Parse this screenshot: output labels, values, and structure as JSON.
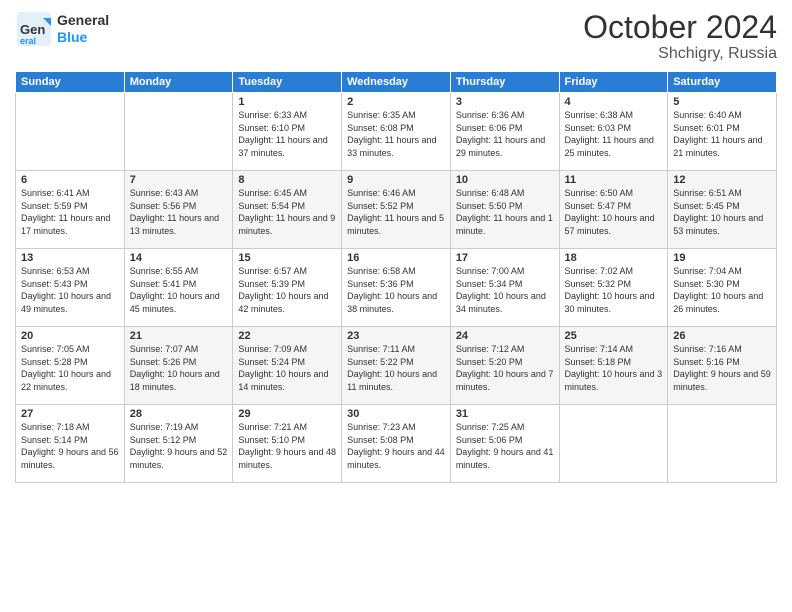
{
  "logo": {
    "general": "General",
    "blue": "Blue"
  },
  "header": {
    "month": "October 2024",
    "location": "Shchigry, Russia"
  },
  "weekdays": [
    "Sunday",
    "Monday",
    "Tuesday",
    "Wednesday",
    "Thursday",
    "Friday",
    "Saturday"
  ],
  "weeks": [
    [
      {
        "day": "",
        "sunrise": "",
        "sunset": "",
        "daylight": ""
      },
      {
        "day": "",
        "sunrise": "",
        "sunset": "",
        "daylight": ""
      },
      {
        "day": "1",
        "sunrise": "Sunrise: 6:33 AM",
        "sunset": "Sunset: 6:10 PM",
        "daylight": "Daylight: 11 hours and 37 minutes."
      },
      {
        "day": "2",
        "sunrise": "Sunrise: 6:35 AM",
        "sunset": "Sunset: 6:08 PM",
        "daylight": "Daylight: 11 hours and 33 minutes."
      },
      {
        "day": "3",
        "sunrise": "Sunrise: 6:36 AM",
        "sunset": "Sunset: 6:06 PM",
        "daylight": "Daylight: 11 hours and 29 minutes."
      },
      {
        "day": "4",
        "sunrise": "Sunrise: 6:38 AM",
        "sunset": "Sunset: 6:03 PM",
        "daylight": "Daylight: 11 hours and 25 minutes."
      },
      {
        "day": "5",
        "sunrise": "Sunrise: 6:40 AM",
        "sunset": "Sunset: 6:01 PM",
        "daylight": "Daylight: 11 hours and 21 minutes."
      }
    ],
    [
      {
        "day": "6",
        "sunrise": "Sunrise: 6:41 AM",
        "sunset": "Sunset: 5:59 PM",
        "daylight": "Daylight: 11 hours and 17 minutes."
      },
      {
        "day": "7",
        "sunrise": "Sunrise: 6:43 AM",
        "sunset": "Sunset: 5:56 PM",
        "daylight": "Daylight: 11 hours and 13 minutes."
      },
      {
        "day": "8",
        "sunrise": "Sunrise: 6:45 AM",
        "sunset": "Sunset: 5:54 PM",
        "daylight": "Daylight: 11 hours and 9 minutes."
      },
      {
        "day": "9",
        "sunrise": "Sunrise: 6:46 AM",
        "sunset": "Sunset: 5:52 PM",
        "daylight": "Daylight: 11 hours and 5 minutes."
      },
      {
        "day": "10",
        "sunrise": "Sunrise: 6:48 AM",
        "sunset": "Sunset: 5:50 PM",
        "daylight": "Daylight: 11 hours and 1 minute."
      },
      {
        "day": "11",
        "sunrise": "Sunrise: 6:50 AM",
        "sunset": "Sunset: 5:47 PM",
        "daylight": "Daylight: 10 hours and 57 minutes."
      },
      {
        "day": "12",
        "sunrise": "Sunrise: 6:51 AM",
        "sunset": "Sunset: 5:45 PM",
        "daylight": "Daylight: 10 hours and 53 minutes."
      }
    ],
    [
      {
        "day": "13",
        "sunrise": "Sunrise: 6:53 AM",
        "sunset": "Sunset: 5:43 PM",
        "daylight": "Daylight: 10 hours and 49 minutes."
      },
      {
        "day": "14",
        "sunrise": "Sunrise: 6:55 AM",
        "sunset": "Sunset: 5:41 PM",
        "daylight": "Daylight: 10 hours and 45 minutes."
      },
      {
        "day": "15",
        "sunrise": "Sunrise: 6:57 AM",
        "sunset": "Sunset: 5:39 PM",
        "daylight": "Daylight: 10 hours and 42 minutes."
      },
      {
        "day": "16",
        "sunrise": "Sunrise: 6:58 AM",
        "sunset": "Sunset: 5:36 PM",
        "daylight": "Daylight: 10 hours and 38 minutes."
      },
      {
        "day": "17",
        "sunrise": "Sunrise: 7:00 AM",
        "sunset": "Sunset: 5:34 PM",
        "daylight": "Daylight: 10 hours and 34 minutes."
      },
      {
        "day": "18",
        "sunrise": "Sunrise: 7:02 AM",
        "sunset": "Sunset: 5:32 PM",
        "daylight": "Daylight: 10 hours and 30 minutes."
      },
      {
        "day": "19",
        "sunrise": "Sunrise: 7:04 AM",
        "sunset": "Sunset: 5:30 PM",
        "daylight": "Daylight: 10 hours and 26 minutes."
      }
    ],
    [
      {
        "day": "20",
        "sunrise": "Sunrise: 7:05 AM",
        "sunset": "Sunset: 5:28 PM",
        "daylight": "Daylight: 10 hours and 22 minutes."
      },
      {
        "day": "21",
        "sunrise": "Sunrise: 7:07 AM",
        "sunset": "Sunset: 5:26 PM",
        "daylight": "Daylight: 10 hours and 18 minutes."
      },
      {
        "day": "22",
        "sunrise": "Sunrise: 7:09 AM",
        "sunset": "Sunset: 5:24 PM",
        "daylight": "Daylight: 10 hours and 14 minutes."
      },
      {
        "day": "23",
        "sunrise": "Sunrise: 7:11 AM",
        "sunset": "Sunset: 5:22 PM",
        "daylight": "Daylight: 10 hours and 11 minutes."
      },
      {
        "day": "24",
        "sunrise": "Sunrise: 7:12 AM",
        "sunset": "Sunset: 5:20 PM",
        "daylight": "Daylight: 10 hours and 7 minutes."
      },
      {
        "day": "25",
        "sunrise": "Sunrise: 7:14 AM",
        "sunset": "Sunset: 5:18 PM",
        "daylight": "Daylight: 10 hours and 3 minutes."
      },
      {
        "day": "26",
        "sunrise": "Sunrise: 7:16 AM",
        "sunset": "Sunset: 5:16 PM",
        "daylight": "Daylight: 9 hours and 59 minutes."
      }
    ],
    [
      {
        "day": "27",
        "sunrise": "Sunrise: 7:18 AM",
        "sunset": "Sunset: 5:14 PM",
        "daylight": "Daylight: 9 hours and 56 minutes."
      },
      {
        "day": "28",
        "sunrise": "Sunrise: 7:19 AM",
        "sunset": "Sunset: 5:12 PM",
        "daylight": "Daylight: 9 hours and 52 minutes."
      },
      {
        "day": "29",
        "sunrise": "Sunrise: 7:21 AM",
        "sunset": "Sunset: 5:10 PM",
        "daylight": "Daylight: 9 hours and 48 minutes."
      },
      {
        "day": "30",
        "sunrise": "Sunrise: 7:23 AM",
        "sunset": "Sunset: 5:08 PM",
        "daylight": "Daylight: 9 hours and 44 minutes."
      },
      {
        "day": "31",
        "sunrise": "Sunrise: 7:25 AM",
        "sunset": "Sunset: 5:06 PM",
        "daylight": "Daylight: 9 hours and 41 minutes."
      },
      {
        "day": "",
        "sunrise": "",
        "sunset": "",
        "daylight": ""
      },
      {
        "day": "",
        "sunrise": "",
        "sunset": "",
        "daylight": ""
      }
    ]
  ]
}
